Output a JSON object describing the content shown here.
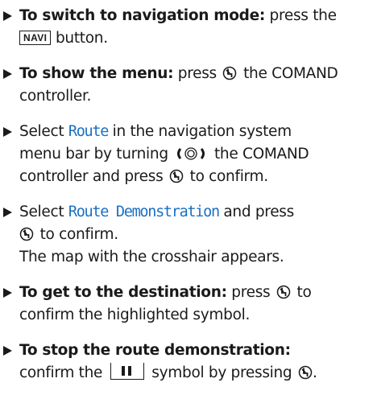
{
  "steps": [
    {
      "bold": "To switch to navigation mode:",
      "text_before_key": " press the",
      "key_label": "NAVI",
      "text_after_key": " button."
    },
    {
      "bold": "To show the menu:",
      "text_press": " press",
      "text_after": " the COMAND",
      "line2": "controller."
    },
    {
      "text_select": "Select ",
      "menu_item": "Route",
      "text_in": " in the navigation system",
      "line2": "menu bar by turning",
      "line2_after": " the COMAND",
      "line3_before": "controller and press",
      "line3_after": " to confirm."
    },
    {
      "text_select": "Select ",
      "menu_item": "Route Demonstration",
      "text_after": " and press",
      "line2_after": " to confirm.",
      "result": "The map with the crosshair appears."
    },
    {
      "bold": "To get to the destination:",
      "text_after": " press",
      "text_to": " to",
      "line2": "confirm the highlighted symbol."
    },
    {
      "bold": "To stop the route demonstration:",
      "line2_before": "confirm the",
      "line2_after": " symbol by pressing",
      "line2_end": "."
    }
  ],
  "icons": {
    "press": "controller-press-icon",
    "turn": "controller-turn-icon",
    "pause": "pause-symbol-icon"
  },
  "colors": {
    "text": "#1a1a1a",
    "menu_item": "#1b6fc3"
  }
}
